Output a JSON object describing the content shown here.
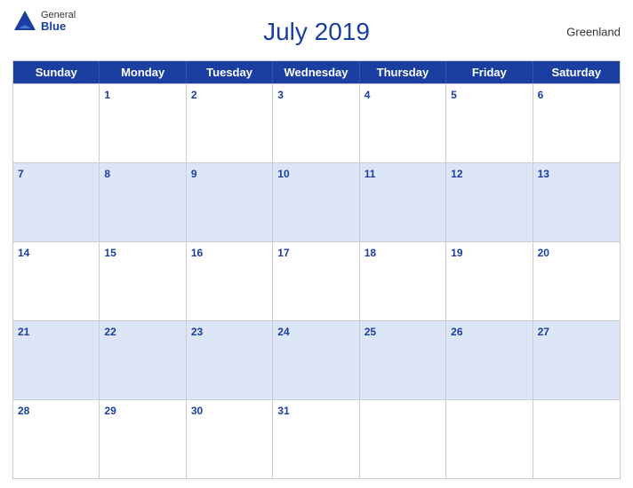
{
  "header": {
    "title": "July 2019",
    "region": "Greenland",
    "logo_general": "General",
    "logo_blue": "Blue"
  },
  "days_of_week": [
    "Sunday",
    "Monday",
    "Tuesday",
    "Wednesday",
    "Thursday",
    "Friday",
    "Saturday"
  ],
  "weeks": [
    [
      {
        "day": "",
        "shaded": false
      },
      {
        "day": "1",
        "shaded": false
      },
      {
        "day": "2",
        "shaded": false
      },
      {
        "day": "3",
        "shaded": false
      },
      {
        "day": "4",
        "shaded": false
      },
      {
        "day": "5",
        "shaded": false
      },
      {
        "day": "6",
        "shaded": false
      }
    ],
    [
      {
        "day": "7",
        "shaded": true
      },
      {
        "day": "8",
        "shaded": true
      },
      {
        "day": "9",
        "shaded": true
      },
      {
        "day": "10",
        "shaded": true
      },
      {
        "day": "11",
        "shaded": true
      },
      {
        "day": "12",
        "shaded": true
      },
      {
        "day": "13",
        "shaded": true
      }
    ],
    [
      {
        "day": "14",
        "shaded": false
      },
      {
        "day": "15",
        "shaded": false
      },
      {
        "day": "16",
        "shaded": false
      },
      {
        "day": "17",
        "shaded": false
      },
      {
        "day": "18",
        "shaded": false
      },
      {
        "day": "19",
        "shaded": false
      },
      {
        "day": "20",
        "shaded": false
      }
    ],
    [
      {
        "day": "21",
        "shaded": true
      },
      {
        "day": "22",
        "shaded": true
      },
      {
        "day": "23",
        "shaded": true
      },
      {
        "day": "24",
        "shaded": true
      },
      {
        "day": "25",
        "shaded": true
      },
      {
        "day": "26",
        "shaded": true
      },
      {
        "day": "27",
        "shaded": true
      }
    ],
    [
      {
        "day": "28",
        "shaded": false
      },
      {
        "day": "29",
        "shaded": false
      },
      {
        "day": "30",
        "shaded": false
      },
      {
        "day": "31",
        "shaded": false
      },
      {
        "day": "",
        "shaded": false
      },
      {
        "day": "",
        "shaded": false
      },
      {
        "day": "",
        "shaded": false
      }
    ]
  ]
}
